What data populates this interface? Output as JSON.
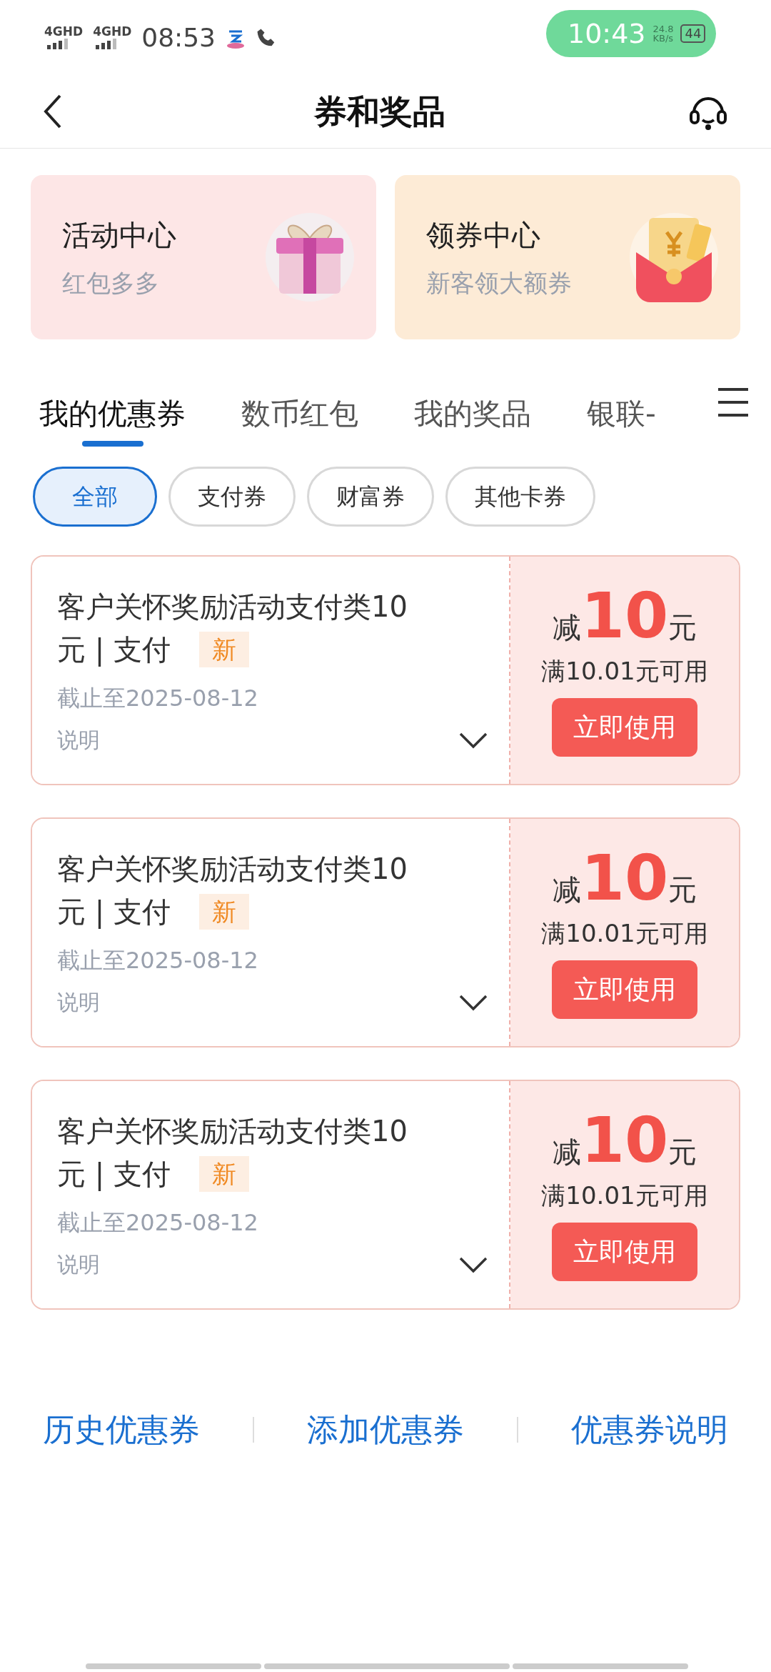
{
  "status_bar": {
    "network_1": "4GHD",
    "network_2": "4GHD",
    "time": "08:53",
    "call_pill": {
      "time": "10:43",
      "speed_value": "24.8",
      "speed_unit": "KB/s",
      "battery": "44"
    }
  },
  "nav": {
    "title": "券和奖品"
  },
  "promo_cards": [
    {
      "kind": "gift",
      "title": "活动中心",
      "subtitle": "红包多多"
    },
    {
      "kind": "envelope",
      "title": "领券中心",
      "subtitle": "新客领大额券"
    }
  ],
  "tabs": [
    {
      "label": "我的优惠券",
      "selected": true
    },
    {
      "label": "数币红包",
      "selected": false
    },
    {
      "label": "我的奖品",
      "selected": false
    },
    {
      "label": "银联-",
      "selected": false
    }
  ],
  "filters": [
    {
      "label": "全部",
      "selected": true
    },
    {
      "label": "支付券",
      "selected": false
    },
    {
      "label": "财富券",
      "selected": false
    },
    {
      "label": "其他卡券",
      "selected": false
    }
  ],
  "coupons": [
    {
      "title_lines": [
        "客户关怀奖励活动支付类10",
        "元 | 支付"
      ],
      "badge": "新",
      "expiry": "截止至2025-08-12",
      "note": "说明",
      "prefix": "减",
      "amount": "10",
      "unit": "元",
      "condition": "满10.01元可用",
      "button": "立即使用"
    },
    {
      "title_lines": [
        "客户关怀奖励活动支付类10",
        "元 | 支付"
      ],
      "badge": "新",
      "expiry": "截止至2025-08-12",
      "note": "说明",
      "prefix": "减",
      "amount": "10",
      "unit": "元",
      "condition": "满10.01元可用",
      "button": "立即使用"
    },
    {
      "title_lines": [
        "客户关怀奖励活动支付类10",
        "元 | 支付"
      ],
      "badge": "新",
      "expiry": "截止至2025-08-12",
      "note": "说明",
      "prefix": "减",
      "amount": "10",
      "unit": "元",
      "condition": "满10.01元可用",
      "button": "立即使用"
    }
  ],
  "footer_links": [
    "历史优惠券",
    "添加优惠券",
    "优惠券说明"
  ]
}
